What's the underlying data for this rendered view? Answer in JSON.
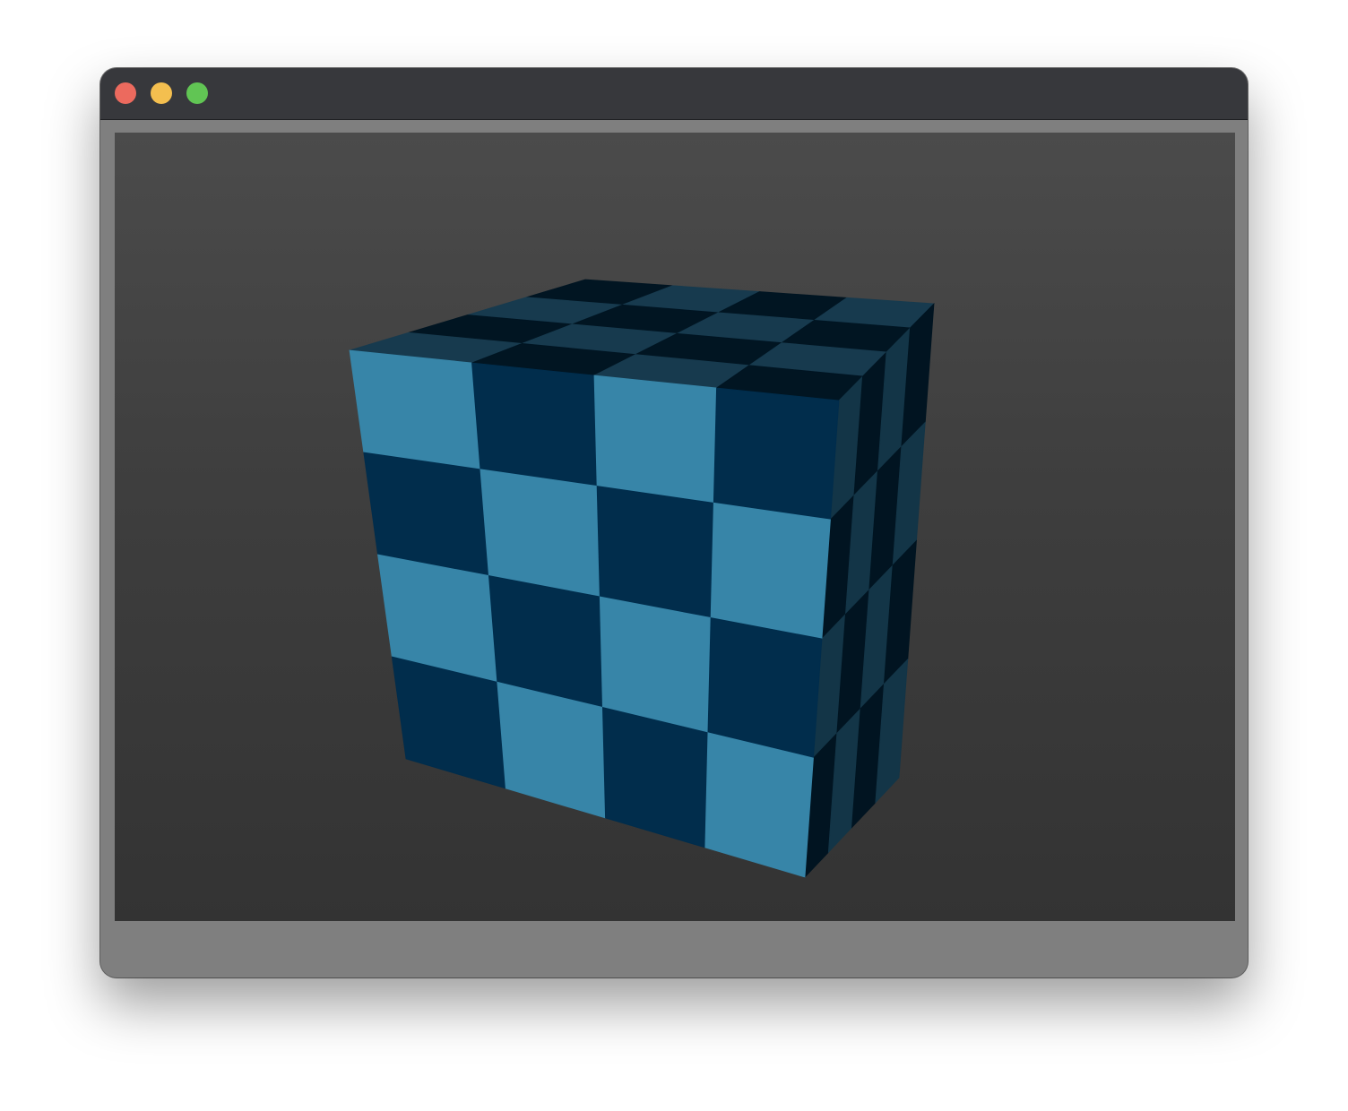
{
  "window": {
    "controls": {
      "close_color": "#ec6a5e",
      "minimize_color": "#f4bf4f",
      "maximize_color": "#61c554"
    }
  },
  "scene": {
    "object": "cube",
    "grid": 4,
    "colors": {
      "front_light": "#3785a8",
      "front_dark": "#012d4c",
      "top_light": "#173a4e",
      "top_dark": "#011522",
      "side_light": "#133547",
      "side_dark": "#011421",
      "background_top": "#4b4b4b",
      "background_bottom": "#333333"
    }
  }
}
